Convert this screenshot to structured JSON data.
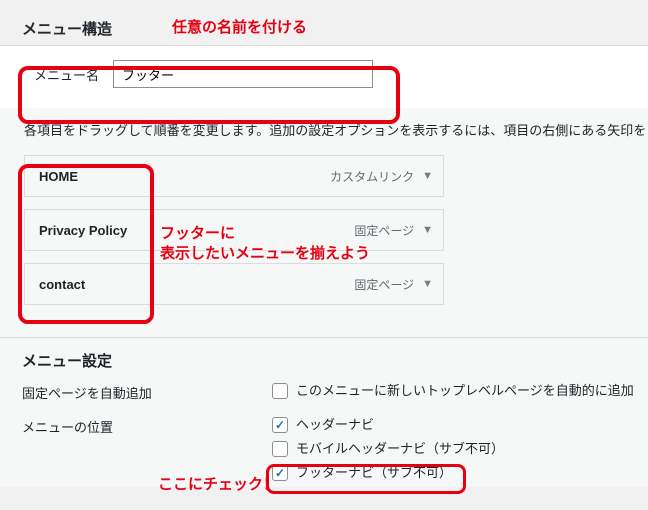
{
  "section_title": "メニュー構造",
  "annotation_title": "任意の名前を付ける",
  "menu_name": {
    "label": "メニュー名",
    "value": "フッター"
  },
  "instruction": "各項目をドラッグして順番を変更します。追加の設定オプションを表示するには、項目の右側にある矢印を",
  "items": [
    {
      "label": "HOME",
      "type": "カスタムリンク"
    },
    {
      "label": "Privacy Policy",
      "type": "固定ページ"
    },
    {
      "label": "contact",
      "type": "固定ページ"
    }
  ],
  "annotation_footer_line1": "フッターに",
  "annotation_footer_line2": "表示したいメニューを揃えよう",
  "settings": {
    "title": "メニュー設定",
    "auto_add_label": "固定ページを自動追加",
    "auto_add_text": "このメニューに新しいトップレベルページを自動的に追加",
    "location_label": "メニューの位置",
    "locations": [
      {
        "label": "ヘッダーナビ",
        "checked": true
      },
      {
        "label": "モバイルヘッダーナビ（サブ不可）",
        "checked": false
      },
      {
        "label": "フッターナビ（サブ不可）",
        "checked": true
      }
    ]
  },
  "annotation_check": "ここにチェック！"
}
